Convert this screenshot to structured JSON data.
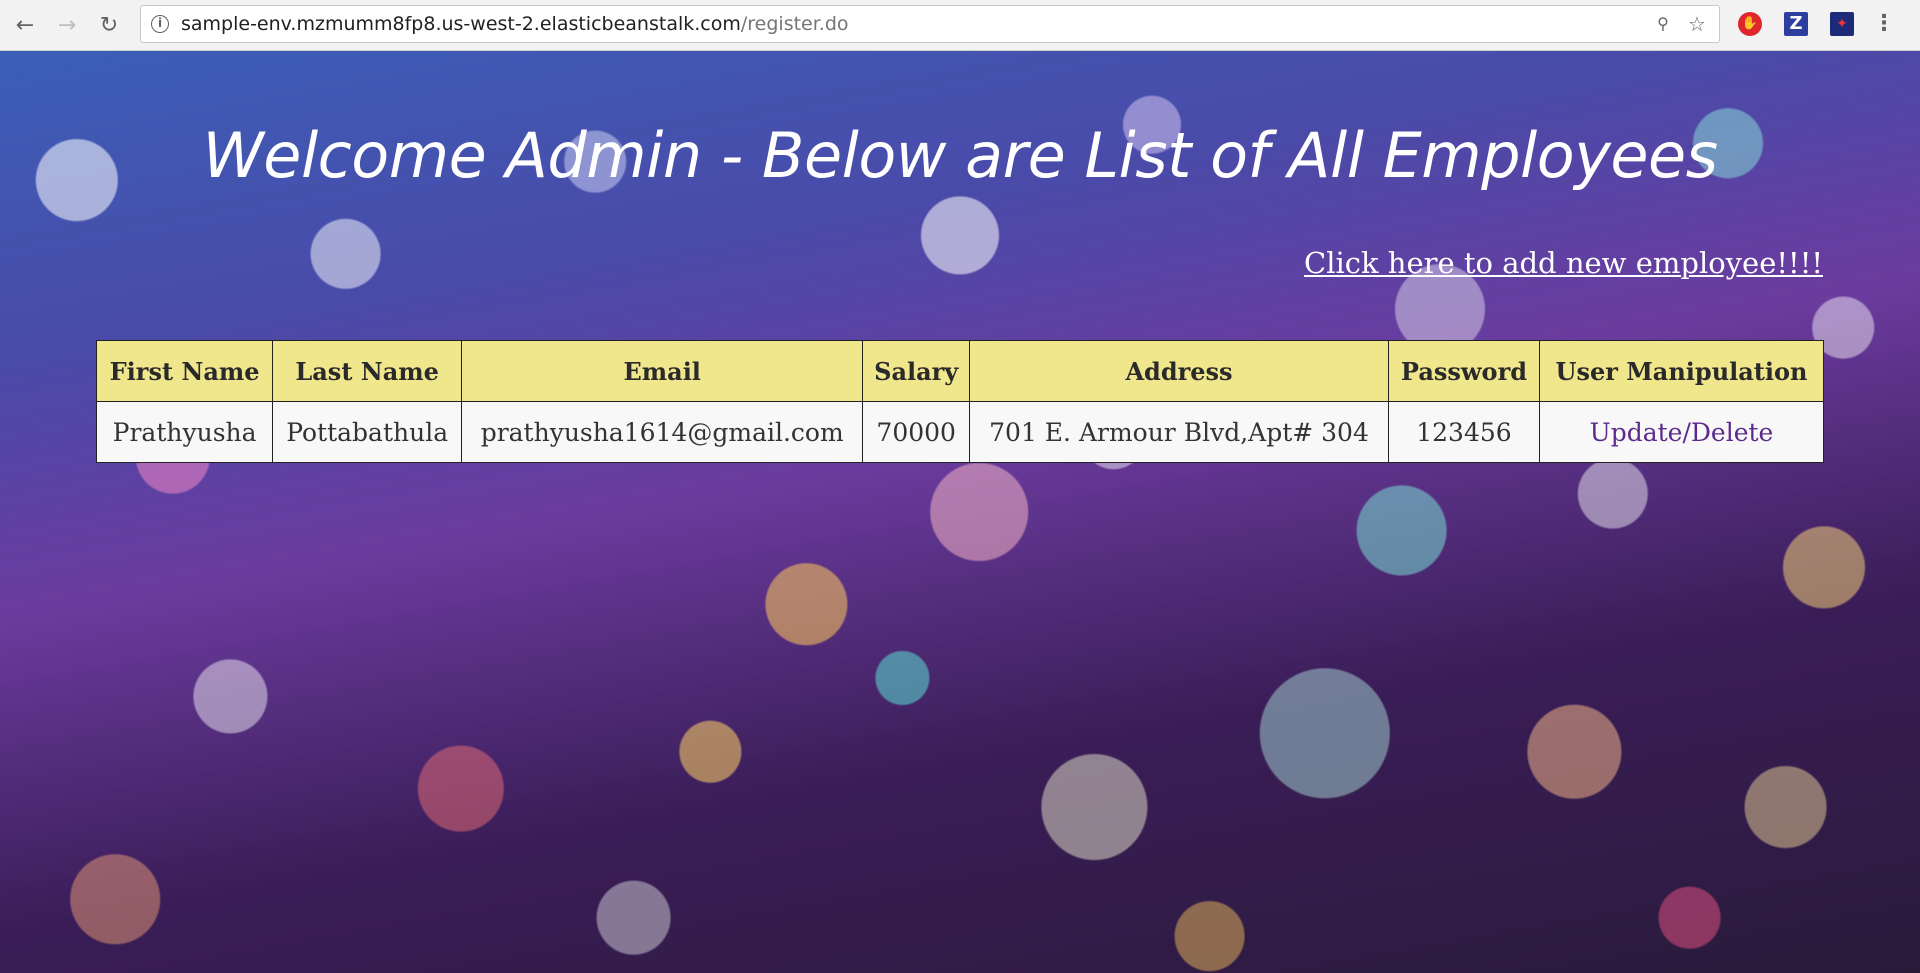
{
  "browser": {
    "url_host": "sample-env.mzmumm8fp8.us-west-2.elasticbeanstalk.com",
    "url_path": "/register.do",
    "icons": [
      "back-icon",
      "forward-icon",
      "reload-icon",
      "info-icon",
      "key-icon",
      "star-icon",
      "adblock-icon",
      "zotero-icon",
      "extension-flag-icon",
      "menu-icon"
    ],
    "extensions": {
      "adblock_label": "ABP",
      "zotero_label": "Z"
    }
  },
  "page": {
    "title": "Welcome Admin - Below are List of All Employees",
    "add_link": "Click here to add new employee!!!!",
    "colors": {
      "header_bg": "#f0e68c",
      "row_bg": "#f8f8f8",
      "link_visited": "#5b2a8c",
      "title_text": "#ffffff"
    }
  },
  "table": {
    "headers": [
      "First Name",
      "Last Name",
      "Email",
      "Salary",
      "Address",
      "Password",
      "User Manipulation"
    ],
    "rows": [
      {
        "first_name": "Prathyusha",
        "last_name": "Pottabathula",
        "email": "prathyusha1614@gmail.com",
        "salary": "70000",
        "address": "701 E. Armour Blvd,Apt# 304",
        "password": "123456",
        "action": "Update/Delete"
      }
    ]
  }
}
